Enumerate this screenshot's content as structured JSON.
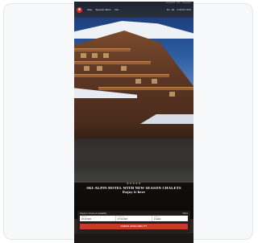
{
  "header": {
    "logo_glyph": "✱",
    "nav": [
      "Stay",
      "Special offers",
      "Info"
    ],
    "utility": [
      "EN · DE",
      "☰ BOOK NOW"
    ],
    "top_strip": [
      "+43 (0)5583 · 2222",
      "Newsletter"
    ]
  },
  "hero": {
    "stars": "★★★★★",
    "headline_line1": "SKI-ALPIN HOTEL WITH NEW SEASON CHALETS",
    "headline_line2": "Enjoy it here"
  },
  "booking": {
    "label": "Check-in / check-out availability",
    "link": "Offers",
    "fields": [
      {
        "label": "Check-in",
        "value": "20.12.2024"
      },
      {
        "label": "Check-out",
        "value": "27.12.2024"
      },
      {
        "label": "Guests",
        "value": "2 Adults"
      }
    ],
    "cta": "CHECK AVAILABILITY"
  },
  "colors": {
    "brand_red": "#d9322b",
    "cta_red": "#c93a2c",
    "star_gold": "#e0b65a"
  }
}
